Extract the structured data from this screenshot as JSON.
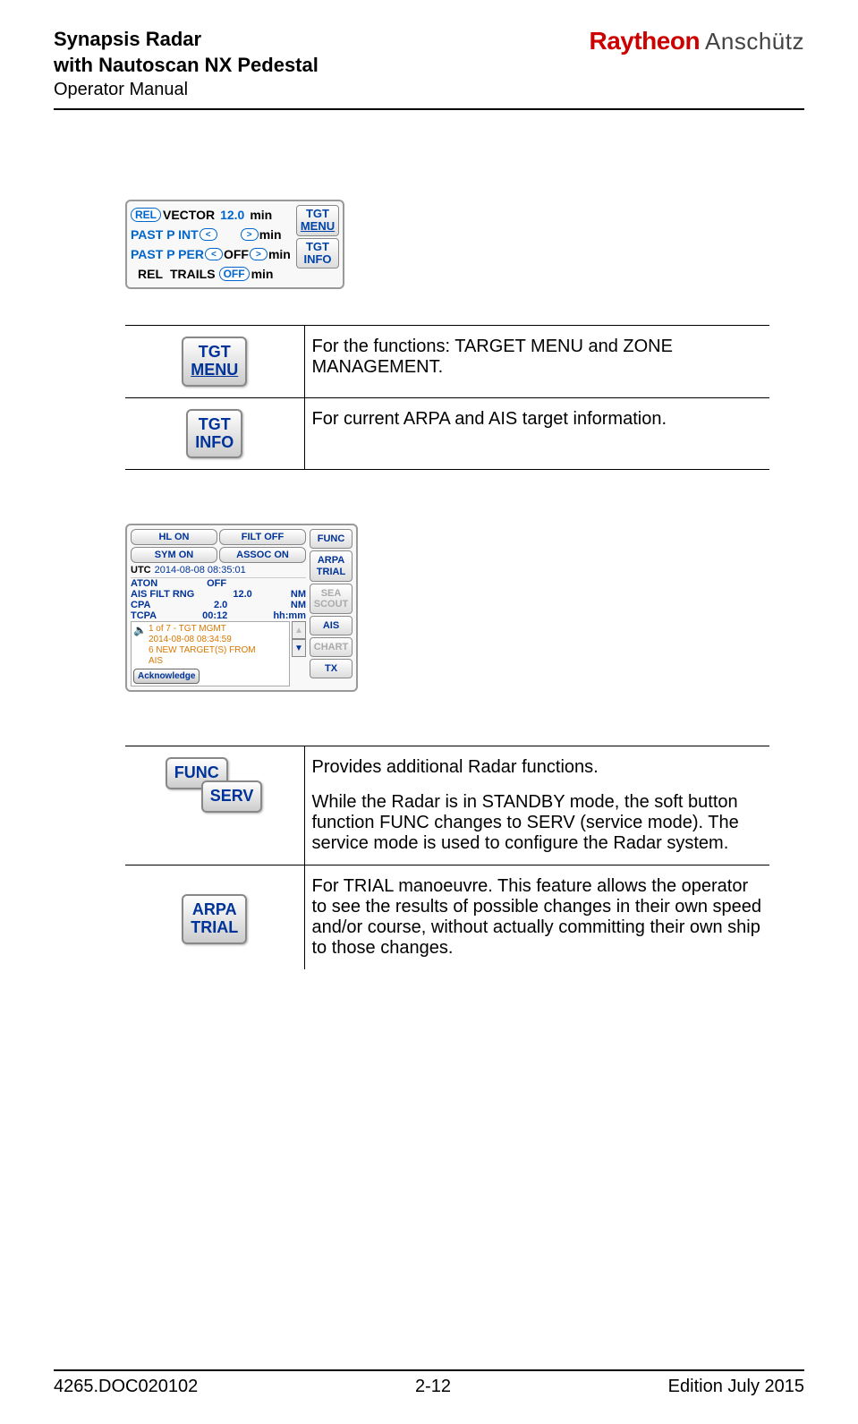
{
  "header": {
    "title1": "Synapsis Radar",
    "title2": "with Nautoscan NX Pedestal",
    "subtitle": "Operator Manual",
    "logo_brand": "Raytheon",
    "logo_sub": "Anschütz"
  },
  "panel1": {
    "rel_pill": "REL",
    "vector": "VECTOR",
    "vector_val": "12.0",
    "min": "min",
    "pastpint": "PAST P INT",
    "lt": "<",
    "gt": ">",
    "pastpper": "PAST P PER",
    "off": "OFF",
    "rel": "REL",
    "trails": "TRAILS",
    "tgt_menu_l1": "TGT",
    "tgt_menu_l2": "MENU",
    "tgt_info_l1": "TGT",
    "tgt_info_l2": "INFO"
  },
  "table1": {
    "r1_btn_l1": "TGT",
    "r1_btn_l2": "MENU",
    "r1_desc": "For the functions: TARGET MENU and ZONE MANAGEMENT.",
    "r2_btn_l1": "TGT",
    "r2_btn_l2": "INFO",
    "r2_desc": "For current ARPA and AIS target information."
  },
  "panel2": {
    "hl_on": "HL ON",
    "filt_off": "FILT OFF",
    "sym_on": "SYM ON",
    "assoc_on": "ASSOC ON",
    "utc": "UTC",
    "utc_val": "2014-08-08  08:35:01",
    "aton": "ATON",
    "aton_val": "OFF",
    "ais_filt": "AIS FILT RNG",
    "ais_filt_val": "12.0",
    "ais_filt_unit": "NM",
    "cpa": "CPA",
    "cpa_val": "2.0",
    "cpa_unit": "NM",
    "tcpa": "TCPA",
    "tcpa_val": "00:12",
    "tcpa_unit": "hh:mm",
    "alarm_l1": "1 of 7 - TGT MGMT",
    "alarm_l2": "2014-08-08 08:34:59",
    "alarm_l3": "6 NEW TARGET(S) FROM",
    "alarm_l4": "AIS",
    "ack": "Acknowledge",
    "func": "FUNC",
    "arpa_trial_l1": "ARPA",
    "arpa_trial_l2": "TRIAL",
    "sea_scout_l1": "SEA",
    "sea_scout_l2": "SCOUT",
    "ais": "AIS",
    "chart": "CHART",
    "tx": "TX"
  },
  "table2": {
    "r1_func": "FUNC",
    "r1_serv": "SERV",
    "r1_desc1": "Provides additional Radar functions.",
    "r1_desc2": "While the Radar is in STANDBY mode, the soft button function FUNC changes to SERV (service mode). The service mode is used to configure the Radar system.",
    "r2_btn_l1": "ARPA",
    "r2_btn_l2": "TRIAL",
    "r2_desc": "For TRIAL manoeuvre. This feature allows the operator to see the results of possible changes in their own speed and/or course, without actually committing their own ship to those changes."
  },
  "footer": {
    "doc": "4265.DOC020102",
    "page": "2-12",
    "edition": "Edition July 2015"
  }
}
